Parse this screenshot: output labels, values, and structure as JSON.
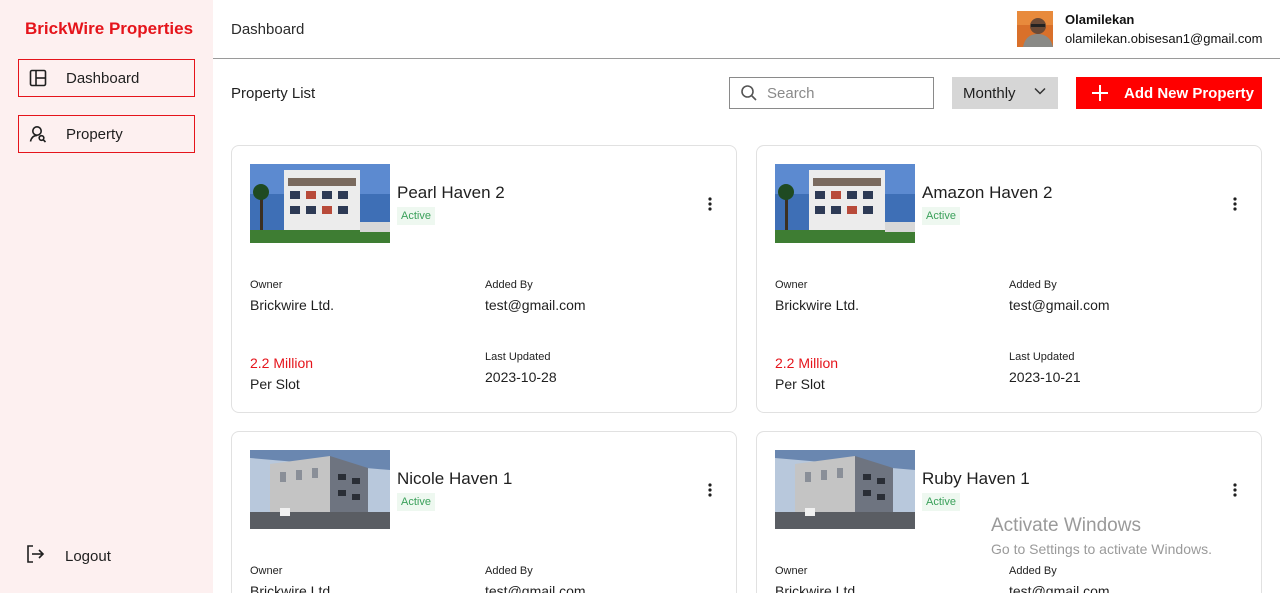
{
  "sidebar": {
    "brand": "BrickWire Properties",
    "items": [
      {
        "label": "Dashboard",
        "icon": "layout-icon"
      },
      {
        "label": "Property",
        "icon": "property-search-icon"
      }
    ],
    "logout_label": "Logout"
  },
  "header": {
    "breadcrumb": "Dashboard",
    "user_name": "Olamilekan",
    "user_email": "olamilekan.obisesan1@gmail.com"
  },
  "toolbar": {
    "title": "Property List",
    "search_placeholder": "Search",
    "period": "Monthly",
    "add_label": "Add New Property"
  },
  "labels": {
    "owner": "Owner",
    "added_by": "Added By",
    "last_updated": "Last Updated"
  },
  "properties": [
    {
      "name": "Pearl Haven 2",
      "status": "Active",
      "owner": "Brickwire Ltd.",
      "added_by": "test@gmail.com",
      "price": "2.2 Million",
      "price_unit": "Per Slot",
      "last_updated": "2023-10-28"
    },
    {
      "name": "Amazon Haven 2",
      "status": "Active",
      "owner": "Brickwire Ltd.",
      "added_by": "test@gmail.com",
      "price": "2.2 Million",
      "price_unit": "Per Slot",
      "last_updated": "2023-10-21"
    },
    {
      "name": "Nicole Haven 1",
      "status": "Active",
      "owner": "Brickwire Ltd.",
      "added_by": "test@gmail.com"
    },
    {
      "name": "Ruby Haven 1",
      "status": "Active",
      "owner": "Brickwire Ltd.",
      "added_by": "test@gmail.com"
    }
  ],
  "watermark": {
    "line1": "Activate Windows",
    "line2": "Go to Settings to activate Windows."
  },
  "colors": {
    "brand": "#e5141b",
    "primary_button": "#ff0000",
    "sidebar_bg": "#fdf0f0",
    "status_text": "#3aa05a"
  }
}
